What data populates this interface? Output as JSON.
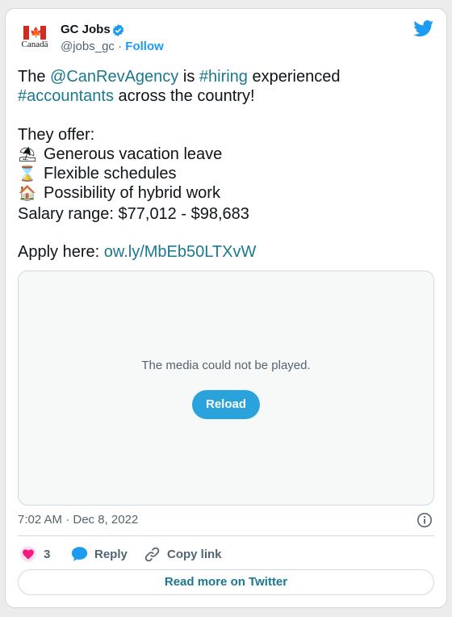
{
  "author": {
    "name": "GC Jobs",
    "handle": "@jobs_gc",
    "separator": " · ",
    "follow": "Follow",
    "logo_wordmark": "Canadä"
  },
  "tweet": {
    "line1_prefix": "The ",
    "mention": "@CanRevAgency",
    "line1_mid": " is ",
    "hashtag_hiring": "#hiring",
    "line1_suffix": " experienced",
    "hashtag_accountants": "#accountants",
    "line2_suffix": " across the country!",
    "offer_intro": "They offer:",
    "benefits": [
      {
        "icon": "beach-umbrella-icon",
        "glyph": "⛱",
        "text": "Generous vacation leave"
      },
      {
        "icon": "hourglass-icon",
        "glyph": "⌛",
        "text": "Flexible schedules"
      },
      {
        "icon": "house-icon",
        "glyph": "🏠",
        "text": "Possibility of hybrid work"
      }
    ],
    "salary": "Salary range: $77,012 - $98,683",
    "apply_label": "Apply here: ",
    "apply_link": "ow.ly/MbEb50LTXvW"
  },
  "media": {
    "message": "The media could not be played.",
    "reload_label": "Reload"
  },
  "meta": {
    "timestamp": "7:02 AM · Dec 8, 2022"
  },
  "actions": {
    "likes": "3",
    "reply_label": "Reply",
    "copy_link_label": "Copy link",
    "read_more_label": "Read more on Twitter"
  },
  "colors": {
    "link": "#1b7890",
    "twitter_blue": "#1d9bf0",
    "like_pink": "#f91880",
    "reload_button": "#2aa3dd"
  }
}
